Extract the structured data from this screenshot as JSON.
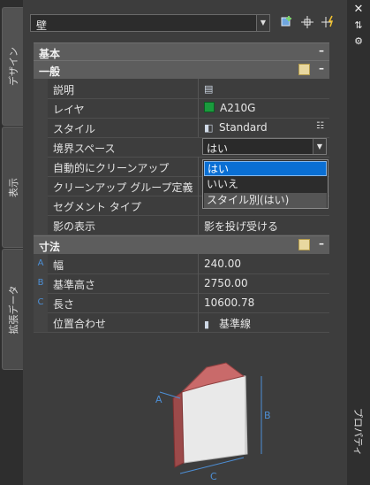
{
  "window": {
    "title": "プロパティ"
  },
  "tabs": [
    "デザイン",
    "表示",
    "拡張データ"
  ],
  "selector": {
    "value": "壁"
  },
  "categories": {
    "basic": "基本",
    "general": "一般",
    "dimensions": "寸法"
  },
  "general_rows": [
    {
      "name": "説明",
      "value": ""
    },
    {
      "name": "レイヤ",
      "value": "A210G"
    },
    {
      "name": "スタイル",
      "value": "Standard"
    },
    {
      "name": "境界スペース",
      "value": "はい"
    },
    {
      "name": "自動的にクリーンアップ",
      "value": ""
    },
    {
      "name": "クリーンアップ グループ定義",
      "value": ""
    },
    {
      "name": "セグメント タイプ",
      "value": ""
    },
    {
      "name": "影の表示",
      "value": "影を投げ受ける"
    }
  ],
  "dropdown_options": [
    "はい",
    "いいえ",
    "スタイル別(はい)"
  ],
  "dimension_rows": [
    {
      "marker": "A",
      "name": "幅",
      "value": "240.00"
    },
    {
      "marker": "B",
      "name": "基準高さ",
      "value": "2750.00"
    },
    {
      "marker": "C",
      "name": "長さ",
      "value": "10600.78"
    },
    {
      "marker": "",
      "name": "位置合わせ",
      "value": "基準線"
    }
  ],
  "illustration_labels": {
    "a": "A",
    "b": "B",
    "c": "C"
  },
  "colors": {
    "layer_swatch": "#1a9b3d",
    "selection": "#0a6fd4"
  }
}
